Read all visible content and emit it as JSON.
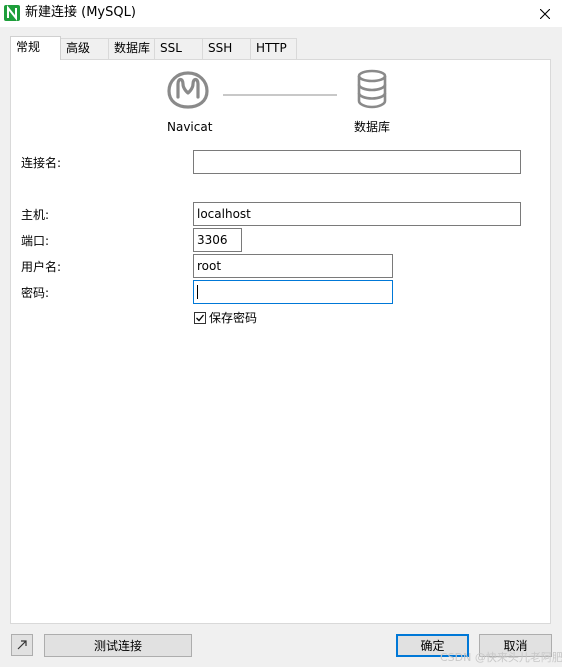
{
  "window": {
    "title": "新建连接 (MySQL)",
    "close_icon": "close-icon"
  },
  "tabs": [
    {
      "label": "常规",
      "active": true
    },
    {
      "label": "高级",
      "active": false
    },
    {
      "label": "数据库",
      "active": false
    },
    {
      "label": "SSL",
      "active": false
    },
    {
      "label": "SSH",
      "active": false
    },
    {
      "label": "HTTP",
      "active": false
    }
  ],
  "header": {
    "client_label": "Navicat",
    "server_label": "数据库"
  },
  "form": {
    "connection_name": {
      "label": "连接名:",
      "value": ""
    },
    "host": {
      "label": "主机:",
      "value": "localhost"
    },
    "port": {
      "label": "端口:",
      "value": "3306"
    },
    "username": {
      "label": "用户名:",
      "value": "root"
    },
    "password": {
      "label": "密码:",
      "value": ""
    },
    "save_password": {
      "label": "保存密码",
      "checked": true
    }
  },
  "footer": {
    "test_button": "测试连接",
    "ok_button": "确定",
    "cancel_button": "取消"
  },
  "watermark": "CSDN @快来头儿老阿肥",
  "colors": {
    "accent": "#0078d7",
    "navicat_green": "#1e9e3b"
  }
}
